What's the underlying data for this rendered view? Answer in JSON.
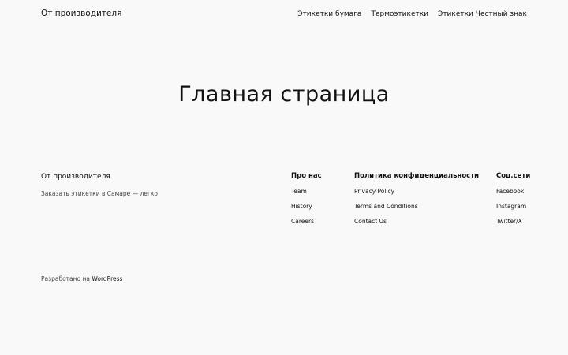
{
  "header": {
    "site_title": "От производителя",
    "nav": [
      {
        "label": "Этикетки бумага"
      },
      {
        "label": "Термоэтикетки"
      },
      {
        "label": "Этикетки Честный знак"
      }
    ]
  },
  "main": {
    "title": "Главная страница"
  },
  "footer": {
    "brand": "От производителя",
    "tagline": "Заказать этикетки в Самаре — легко",
    "columns": [
      {
        "title": "Про нас",
        "links": [
          "Team",
          "History",
          "Careers"
        ]
      },
      {
        "title": "Политика конфиденциальности",
        "links": [
          "Privacy Policy",
          "Terms and Conditions",
          "Contact Us"
        ]
      },
      {
        "title": "Соц.сети",
        "links": [
          "Facebook",
          "Instagram",
          "Twitter/X"
        ]
      }
    ],
    "credit_prefix": "Разработано на ",
    "credit_link": "WordPress"
  },
  "colors": {
    "background": "#f9f9f9",
    "text": "#111111",
    "muted_text": "#444444"
  }
}
